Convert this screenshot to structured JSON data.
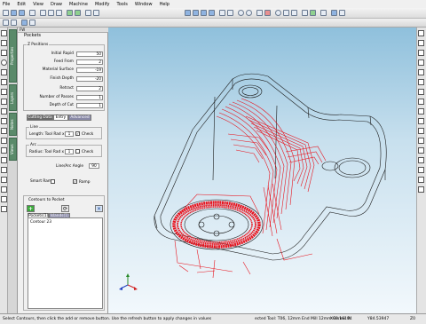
{
  "menu": [
    "File",
    "Edit",
    "View",
    "Draw",
    "Machine",
    "Modify",
    "Tools",
    "Window",
    "Help"
  ],
  "side_tabs": [
    "Properties",
    "Layers",
    "Notes",
    "Views"
  ],
  "panel": {
    "header": "FW",
    "title": "Pockets",
    "z_positions": {
      "title": "Z Positions",
      "rows": [
        {
          "label": "Initial Rapid",
          "value": "50"
        },
        {
          "label": "Feed From",
          "value": "2"
        },
        {
          "label": "Material Surface",
          "value": "-19"
        },
        {
          "label": "Finish Depth",
          "value": "-20"
        },
        {
          "label": "Retract",
          "value": "2"
        },
        {
          "label": "Number of Passes",
          "value": "1"
        },
        {
          "label": "Depth of Cut",
          "value": "1"
        }
      ]
    },
    "tabs": [
      "Cutting Data",
      "Entry",
      "Advanced"
    ],
    "line_group": {
      "title": "Line",
      "label": "Length: Tool Rad x",
      "value": "1",
      "check_label": "Check",
      "checked": true
    },
    "arc_group": {
      "title": "Arc",
      "label": "Radius: Tool Rad x",
      "value": "1",
      "check_label": "Check",
      "checked": false
    },
    "angle": {
      "label": "Line/Arc Angle",
      "value": "90"
    },
    "smart_ramp": {
      "label": "Smart Ramp",
      "checked": false
    },
    "ramp": {
      "label": "Ramp",
      "checked": true
    },
    "contours": {
      "title": "Contours to Pocket",
      "list_tabs": [
        "Pockets(1)",
        "Islands(1)"
      ],
      "items": [
        "Contour 23"
      ]
    }
  },
  "status": {
    "hint": "Select Contours, then click the add or remove button. Use the refresh button to apply changes in values",
    "tool": "ected Tool: T06, 12mm End Mill 12mm Corner R",
    "x": "X98.16104",
    "y": "Y84.53947",
    "z": "Z0"
  },
  "colors": {
    "toolpath": "#e8141e",
    "geometry": "#1a1a1a",
    "viewport_top": "#8fc0dc",
    "viewport_bottom": "#f2f8fc"
  }
}
